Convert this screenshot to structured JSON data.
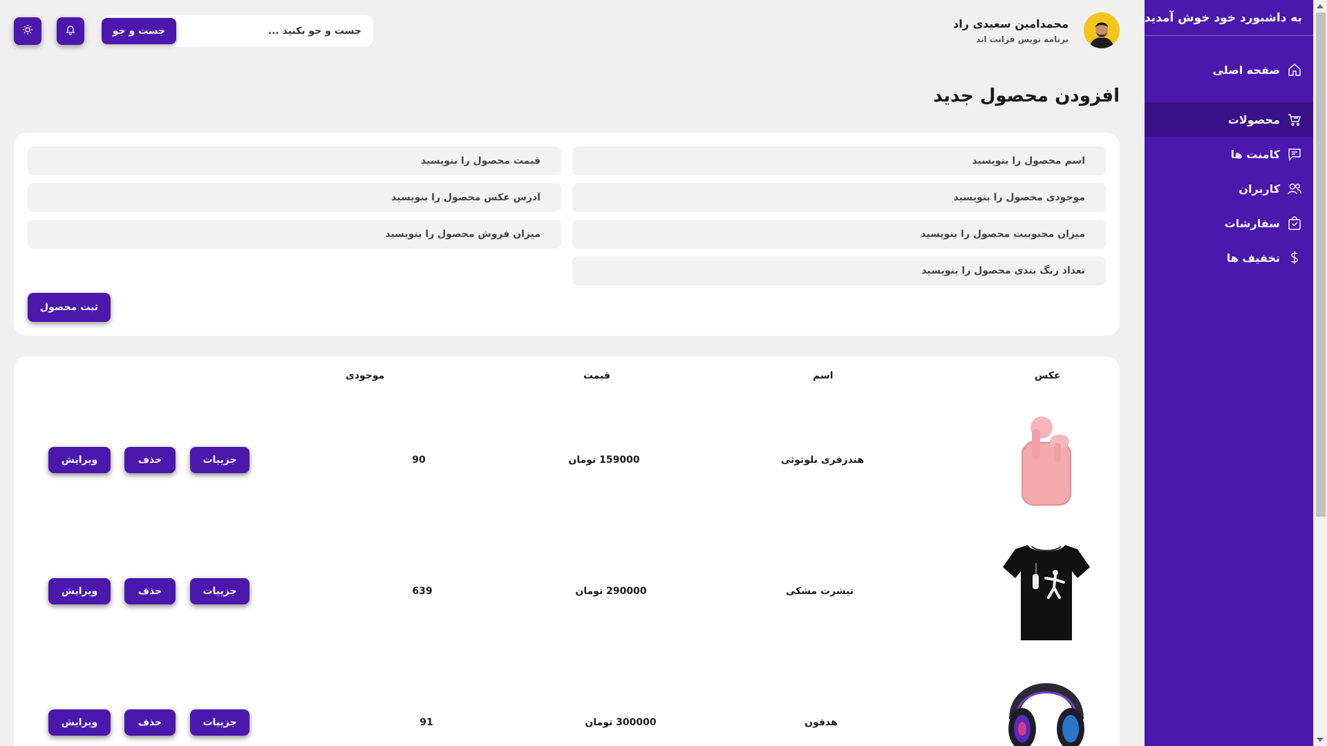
{
  "sidebar": {
    "title": "به داشبورد خود خوش آمدید",
    "items": [
      {
        "label": "صفحه اصلی",
        "icon": "home-icon"
      },
      {
        "label": "محصولات",
        "icon": "cart-icon",
        "active": true
      },
      {
        "label": "کامنت ها",
        "icon": "comment-icon"
      },
      {
        "label": "کاربران",
        "icon": "users-icon"
      },
      {
        "label": "سفارشات",
        "icon": "shopping-bag-icon"
      },
      {
        "label": "تخفیف ها",
        "icon": "dollar-icon"
      }
    ]
  },
  "header": {
    "profile_name": "محمدامین سعیدی راد",
    "profile_role": "برنامه نویس فرانت اند",
    "search_placeholder": "جست و جو بکنید ...",
    "search_button": "جست و جو",
    "notification_icon": "bell-icon",
    "theme_icon": "sun-icon"
  },
  "form": {
    "title": "افزودن محصول جدید",
    "placeholders": {
      "name": "اسم محصول را بنویسید",
      "price": "قیمت محصول را بنویسید",
      "stock": "موجودی محصول را بنویسید",
      "image": "آدرس عکس محصول را بنویسید",
      "popularity": "میزان محبوبیت محصول را بنویسید",
      "sales": "میزان فروش محصول را بنویسید",
      "colors": "تعداد رنگ بندی محصول را بنویسید"
    },
    "submit_label": "ثبت محصول"
  },
  "table": {
    "headers": {
      "image": "عکس",
      "name": "اسم",
      "price": "قیمت",
      "stock": "موجودی"
    },
    "buttons": {
      "details": "جزییات",
      "delete": "حذف",
      "edit": "ویرایش"
    },
    "rows": [
      {
        "name": "هندزفری بلوتوثی",
        "price": "159000 تومان",
        "stock": "90",
        "image": "pink-earbuds"
      },
      {
        "name": "تیشرت مشکی",
        "price": "290000 تومان",
        "stock": "639",
        "image": "black-tshirt"
      },
      {
        "name": "هدفون",
        "price": "300000 تومان",
        "stock": "91",
        "image": "headphones"
      }
    ]
  },
  "colors": {
    "accent": "#4b17ad",
    "accent_dark": "#3a1089",
    "background": "#f0f0f1"
  }
}
